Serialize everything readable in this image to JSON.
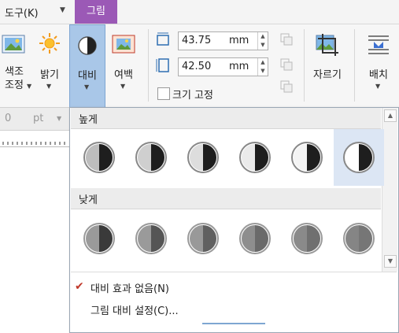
{
  "menubar": {
    "tool_menu": "도구(K)",
    "active_tab": "그림"
  },
  "ribbon": {
    "color_adjust": [
      "색조",
      "조정"
    ],
    "brightness": "밝기",
    "contrast": "대비",
    "margin": "여백",
    "width_value": "43.75",
    "height_value": "42.50",
    "unit": "mm",
    "size_lock": "크기 고정",
    "crop": "자르기",
    "arrange": "배치"
  },
  "docbar": {
    "field_value": "0",
    "field_unit": "pt"
  },
  "panel": {
    "high_section": "높게",
    "low_section": "낮게",
    "no_contrast": "대비 효과 없음(N)",
    "contrast_settings": "그림 대비 설정(C)..."
  },
  "colors": {
    "tab_accent": "#9b59b6",
    "selection_bg": "#dce6f4",
    "check": "#c0392b"
  },
  "icons": {
    "contrast_icon": "half-circle",
    "check_icon": "checkmark"
  }
}
